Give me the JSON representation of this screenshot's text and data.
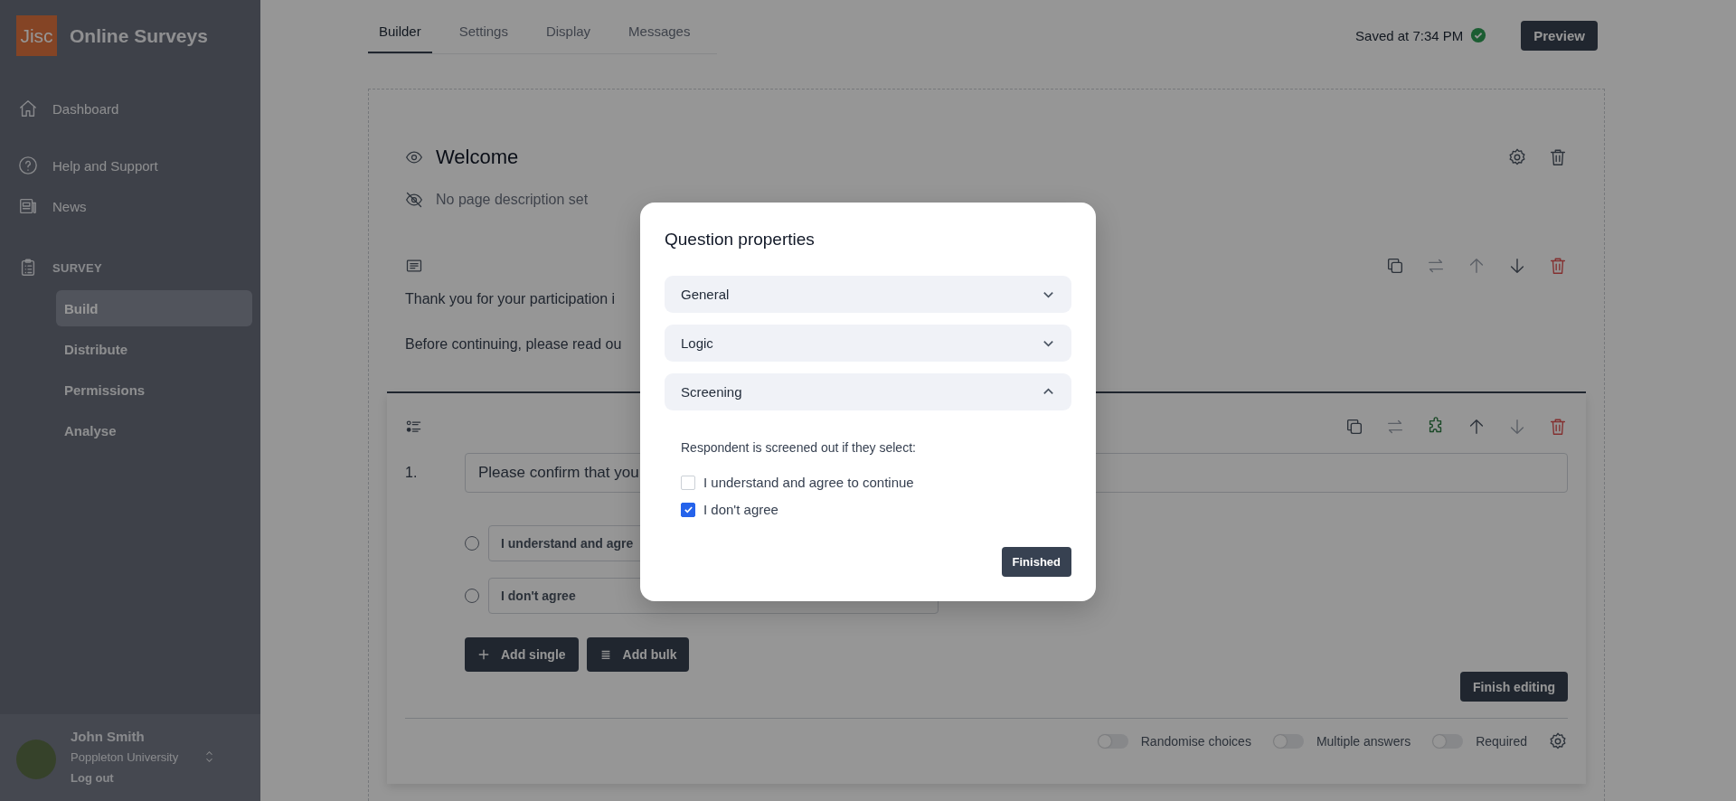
{
  "sidebar": {
    "logo": "Jisc",
    "app_name": "Online Surveys",
    "nav": [
      {
        "label": "Dashboard"
      },
      {
        "label": "Help and Support"
      },
      {
        "label": "News"
      }
    ],
    "section": "SURVEY",
    "items": [
      {
        "label": "Build",
        "selected": true
      },
      {
        "label": "Distribute",
        "selected": false
      },
      {
        "label": "Permissions",
        "selected": false
      },
      {
        "label": "Analyse",
        "selected": false
      }
    ],
    "user": {
      "name": "John Smith",
      "organisation": "Poppleton University",
      "logout": "Log out"
    }
  },
  "tabs": [
    {
      "label": "Builder",
      "selected": true
    },
    {
      "label": "Settings",
      "selected": false
    },
    {
      "label": "Display",
      "selected": false
    },
    {
      "label": "Messages",
      "selected": false
    }
  ],
  "save_status": "Saved at 7:34 PM",
  "preview_button": "Preview",
  "page": {
    "title": "Welcome",
    "description": "No page description set"
  },
  "text_block": {
    "paragraphs": [
      "Thank you for your participation i",
      "Before continuing, please read ou"
    ]
  },
  "question": {
    "number": "1.",
    "text": "Please confirm that you",
    "choices": [
      {
        "label": "I understand and agre",
        "selected": false
      },
      {
        "label": "I don't agree",
        "selected": false
      }
    ],
    "add_single": "Add single",
    "add_bulk": "Add bulk",
    "finish_button": "Finish editing",
    "toggles": [
      {
        "label": "Randomise choices",
        "on": false
      },
      {
        "label": "Multiple answers",
        "on": false
      },
      {
        "label": "Required",
        "on": false
      }
    ]
  },
  "modal": {
    "title": "Question properties",
    "sections": [
      {
        "label": "General",
        "expanded": false
      },
      {
        "label": "Logic",
        "expanded": false
      },
      {
        "label": "Screening",
        "expanded": true,
        "prompt": "Respondent is screened out if they select:",
        "options": [
          {
            "label": "I understand and agree to continue",
            "checked": false
          },
          {
            "label": "I don't agree",
            "checked": true
          }
        ]
      }
    ],
    "button": "Finished"
  }
}
